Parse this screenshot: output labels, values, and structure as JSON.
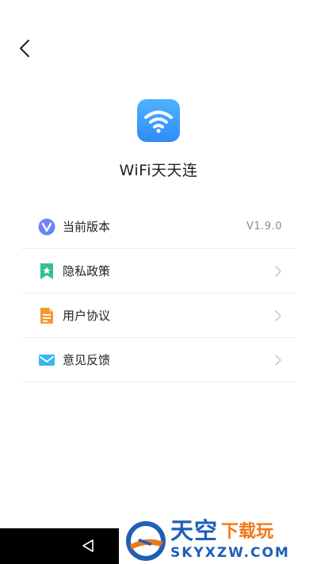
{
  "header": {
    "back_icon": "chevron-left-icon"
  },
  "app": {
    "name": "WiFi天天连",
    "icon": "wifi-icon",
    "icon_color": "#3a9bf7"
  },
  "menu": {
    "items": [
      {
        "label": "当前版本",
        "value": "V1.9.0",
        "icon": "v-badge-icon"
      },
      {
        "label": "隐私政策",
        "icon": "bookmark-star-icon"
      },
      {
        "label": "用户协议",
        "icon": "document-icon"
      },
      {
        "label": "意见反馈",
        "icon": "mail-icon"
      }
    ]
  },
  "watermark": {
    "main": "天空",
    "sub": "下载玩",
    "domain": "SKYXZW.COM"
  }
}
